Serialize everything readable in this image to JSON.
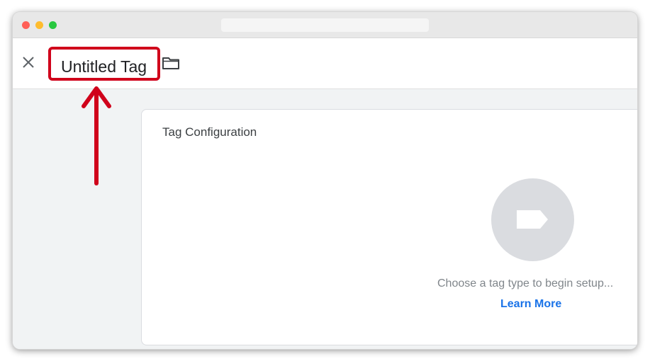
{
  "toolbar": {
    "tag_name": "Untitled Tag"
  },
  "card": {
    "title": "Tag Configuration",
    "hint": "Choose a tag type to begin setup...",
    "learn_more": "Learn More"
  },
  "icons": {
    "close": "close-icon",
    "folder": "folder-icon",
    "tag_type": "tag-icon",
    "annotation": "arrow-up-icon"
  },
  "colors": {
    "highlight": "#d0021b",
    "link": "#1a73e8",
    "placeholder_circle": "#dadce0"
  }
}
